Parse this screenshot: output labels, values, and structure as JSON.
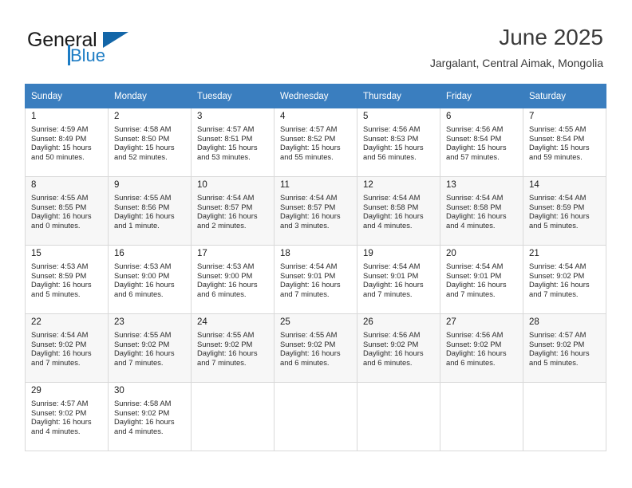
{
  "brand": {
    "name_part1": "General",
    "name_part2": "Blue",
    "flag_icon": "triangle-flag-icon"
  },
  "header": {
    "month_title": "June 2025",
    "location": "Jargalant, Central Aimak, Mongolia"
  },
  "colors": {
    "header_blue": "#3a7ebf",
    "brand_blue": "#1c7cc4",
    "row_shaded": "#f7f7f7",
    "grid_line": "#d9d9d9"
  },
  "calendar": {
    "weekday_headers": [
      "Sunday",
      "Monday",
      "Tuesday",
      "Wednesday",
      "Thursday",
      "Friday",
      "Saturday"
    ],
    "weeks": [
      {
        "shaded": false,
        "days": [
          {
            "day": "1",
            "sunrise": "Sunrise: 4:59 AM",
            "sunset": "Sunset: 8:49 PM",
            "daylight_line1": "Daylight: 15 hours",
            "daylight_line2": "and 50 minutes."
          },
          {
            "day": "2",
            "sunrise": "Sunrise: 4:58 AM",
            "sunset": "Sunset: 8:50 PM",
            "daylight_line1": "Daylight: 15 hours",
            "daylight_line2": "and 52 minutes."
          },
          {
            "day": "3",
            "sunrise": "Sunrise: 4:57 AM",
            "sunset": "Sunset: 8:51 PM",
            "daylight_line1": "Daylight: 15 hours",
            "daylight_line2": "and 53 minutes."
          },
          {
            "day": "4",
            "sunrise": "Sunrise: 4:57 AM",
            "sunset": "Sunset: 8:52 PM",
            "daylight_line1": "Daylight: 15 hours",
            "daylight_line2": "and 55 minutes."
          },
          {
            "day": "5",
            "sunrise": "Sunrise: 4:56 AM",
            "sunset": "Sunset: 8:53 PM",
            "daylight_line1": "Daylight: 15 hours",
            "daylight_line2": "and 56 minutes."
          },
          {
            "day": "6",
            "sunrise": "Sunrise: 4:56 AM",
            "sunset": "Sunset: 8:54 PM",
            "daylight_line1": "Daylight: 15 hours",
            "daylight_line2": "and 57 minutes."
          },
          {
            "day": "7",
            "sunrise": "Sunrise: 4:55 AM",
            "sunset": "Sunset: 8:54 PM",
            "daylight_line1": "Daylight: 15 hours",
            "daylight_line2": "and 59 minutes."
          }
        ]
      },
      {
        "shaded": true,
        "days": [
          {
            "day": "8",
            "sunrise": "Sunrise: 4:55 AM",
            "sunset": "Sunset: 8:55 PM",
            "daylight_line1": "Daylight: 16 hours",
            "daylight_line2": "and 0 minutes."
          },
          {
            "day": "9",
            "sunrise": "Sunrise: 4:55 AM",
            "sunset": "Sunset: 8:56 PM",
            "daylight_line1": "Daylight: 16 hours",
            "daylight_line2": "and 1 minute."
          },
          {
            "day": "10",
            "sunrise": "Sunrise: 4:54 AM",
            "sunset": "Sunset: 8:57 PM",
            "daylight_line1": "Daylight: 16 hours",
            "daylight_line2": "and 2 minutes."
          },
          {
            "day": "11",
            "sunrise": "Sunrise: 4:54 AM",
            "sunset": "Sunset: 8:57 PM",
            "daylight_line1": "Daylight: 16 hours",
            "daylight_line2": "and 3 minutes."
          },
          {
            "day": "12",
            "sunrise": "Sunrise: 4:54 AM",
            "sunset": "Sunset: 8:58 PM",
            "daylight_line1": "Daylight: 16 hours",
            "daylight_line2": "and 4 minutes."
          },
          {
            "day": "13",
            "sunrise": "Sunrise: 4:54 AM",
            "sunset": "Sunset: 8:58 PM",
            "daylight_line1": "Daylight: 16 hours",
            "daylight_line2": "and 4 minutes."
          },
          {
            "day": "14",
            "sunrise": "Sunrise: 4:54 AM",
            "sunset": "Sunset: 8:59 PM",
            "daylight_line1": "Daylight: 16 hours",
            "daylight_line2": "and 5 minutes."
          }
        ]
      },
      {
        "shaded": false,
        "days": [
          {
            "day": "15",
            "sunrise": "Sunrise: 4:53 AM",
            "sunset": "Sunset: 8:59 PM",
            "daylight_line1": "Daylight: 16 hours",
            "daylight_line2": "and 5 minutes."
          },
          {
            "day": "16",
            "sunrise": "Sunrise: 4:53 AM",
            "sunset": "Sunset: 9:00 PM",
            "daylight_line1": "Daylight: 16 hours",
            "daylight_line2": "and 6 minutes."
          },
          {
            "day": "17",
            "sunrise": "Sunrise: 4:53 AM",
            "sunset": "Sunset: 9:00 PM",
            "daylight_line1": "Daylight: 16 hours",
            "daylight_line2": "and 6 minutes."
          },
          {
            "day": "18",
            "sunrise": "Sunrise: 4:54 AM",
            "sunset": "Sunset: 9:01 PM",
            "daylight_line1": "Daylight: 16 hours",
            "daylight_line2": "and 7 minutes."
          },
          {
            "day": "19",
            "sunrise": "Sunrise: 4:54 AM",
            "sunset": "Sunset: 9:01 PM",
            "daylight_line1": "Daylight: 16 hours",
            "daylight_line2": "and 7 minutes."
          },
          {
            "day": "20",
            "sunrise": "Sunrise: 4:54 AM",
            "sunset": "Sunset: 9:01 PM",
            "daylight_line1": "Daylight: 16 hours",
            "daylight_line2": "and 7 minutes."
          },
          {
            "day": "21",
            "sunrise": "Sunrise: 4:54 AM",
            "sunset": "Sunset: 9:02 PM",
            "daylight_line1": "Daylight: 16 hours",
            "daylight_line2": "and 7 minutes."
          }
        ]
      },
      {
        "shaded": true,
        "days": [
          {
            "day": "22",
            "sunrise": "Sunrise: 4:54 AM",
            "sunset": "Sunset: 9:02 PM",
            "daylight_line1": "Daylight: 16 hours",
            "daylight_line2": "and 7 minutes."
          },
          {
            "day": "23",
            "sunrise": "Sunrise: 4:55 AM",
            "sunset": "Sunset: 9:02 PM",
            "daylight_line1": "Daylight: 16 hours",
            "daylight_line2": "and 7 minutes."
          },
          {
            "day": "24",
            "sunrise": "Sunrise: 4:55 AM",
            "sunset": "Sunset: 9:02 PM",
            "daylight_line1": "Daylight: 16 hours",
            "daylight_line2": "and 7 minutes."
          },
          {
            "day": "25",
            "sunrise": "Sunrise: 4:55 AM",
            "sunset": "Sunset: 9:02 PM",
            "daylight_line1": "Daylight: 16 hours",
            "daylight_line2": "and 6 minutes."
          },
          {
            "day": "26",
            "sunrise": "Sunrise: 4:56 AM",
            "sunset": "Sunset: 9:02 PM",
            "daylight_line1": "Daylight: 16 hours",
            "daylight_line2": "and 6 minutes."
          },
          {
            "day": "27",
            "sunrise": "Sunrise: 4:56 AM",
            "sunset": "Sunset: 9:02 PM",
            "daylight_line1": "Daylight: 16 hours",
            "daylight_line2": "and 6 minutes."
          },
          {
            "day": "28",
            "sunrise": "Sunrise: 4:57 AM",
            "sunset": "Sunset: 9:02 PM",
            "daylight_line1": "Daylight: 16 hours",
            "daylight_line2": "and 5 minutes."
          }
        ]
      },
      {
        "shaded": false,
        "days": [
          {
            "day": "29",
            "sunrise": "Sunrise: 4:57 AM",
            "sunset": "Sunset: 9:02 PM",
            "daylight_line1": "Daylight: 16 hours",
            "daylight_line2": "and 4 minutes."
          },
          {
            "day": "30",
            "sunrise": "Sunrise: 4:58 AM",
            "sunset": "Sunset: 9:02 PM",
            "daylight_line1": "Daylight: 16 hours",
            "daylight_line2": "and 4 minutes."
          },
          {
            "day": "",
            "sunrise": "",
            "sunset": "",
            "daylight_line1": "",
            "daylight_line2": ""
          },
          {
            "day": "",
            "sunrise": "",
            "sunset": "",
            "daylight_line1": "",
            "daylight_line2": ""
          },
          {
            "day": "",
            "sunrise": "",
            "sunset": "",
            "daylight_line1": "",
            "daylight_line2": ""
          },
          {
            "day": "",
            "sunrise": "",
            "sunset": "",
            "daylight_line1": "",
            "daylight_line2": ""
          },
          {
            "day": "",
            "sunrise": "",
            "sunset": "",
            "daylight_line1": "",
            "daylight_line2": ""
          }
        ]
      }
    ]
  }
}
